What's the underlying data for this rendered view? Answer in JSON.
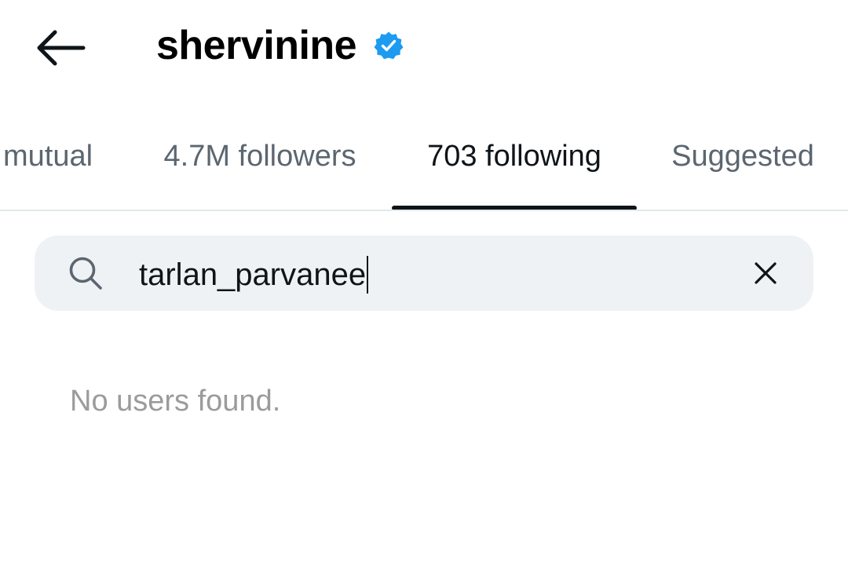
{
  "header": {
    "back_icon": "arrow-left-icon",
    "username": "shervinine",
    "verified_icon": "verified-badge-icon",
    "verified_color": "#1d9bf0"
  },
  "tabs": [
    {
      "label": "mutual",
      "active": false
    },
    {
      "label": "4.7M followers",
      "active": false
    },
    {
      "label": "703 following",
      "active": true
    },
    {
      "label": "Suggested",
      "active": false
    }
  ],
  "search": {
    "icon": "search-icon",
    "value": "tarlan_parvanee",
    "clear_icon": "close-icon"
  },
  "results": {
    "empty_message": "No users found."
  },
  "colors": {
    "text_primary": "#0f1419",
    "text_secondary": "#5b6670",
    "empty_text": "#9b9b9b",
    "search_bg": "#eff2f4",
    "divider": "#e3e8ea"
  }
}
